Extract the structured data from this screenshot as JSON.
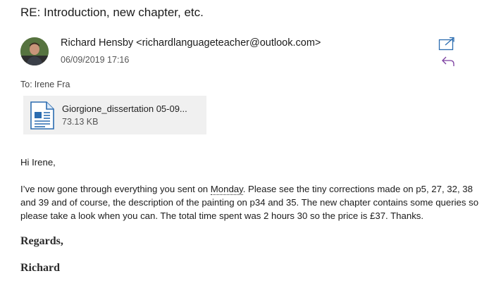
{
  "subject": "RE: Introduction, new chapter, etc.",
  "sender": {
    "display": "Richard Hensby <richardlanguageteacher@outlook.com>",
    "date": "06/09/2019 17:16"
  },
  "recipients": {
    "label": "To:",
    "name": "Irene Fra"
  },
  "attachment": {
    "name": "Giorgione_dissertation 05-09...",
    "size": "73.13 KB",
    "icon": "document-icon"
  },
  "message": {
    "greeting": "Hi Irene,",
    "p1_before": "I’ve now gone through everything you sent on ",
    "p1_link": "Monday",
    "p1_after": ". Please see the tiny corrections made on p5, 27, 32, 38 and 39 and of course, the description of the painting on p34 and 35. The new chapter contains some queries so please take a look when you can. The total time spent was 2 hours 30 so the price is £37. Thanks.",
    "closing": "Regards,",
    "signature": "Richard"
  },
  "colors": {
    "accent_icon": "#2b6cb0",
    "reply_icon": "#7b3fa0",
    "attachment_bg": "#f0f0f0"
  }
}
